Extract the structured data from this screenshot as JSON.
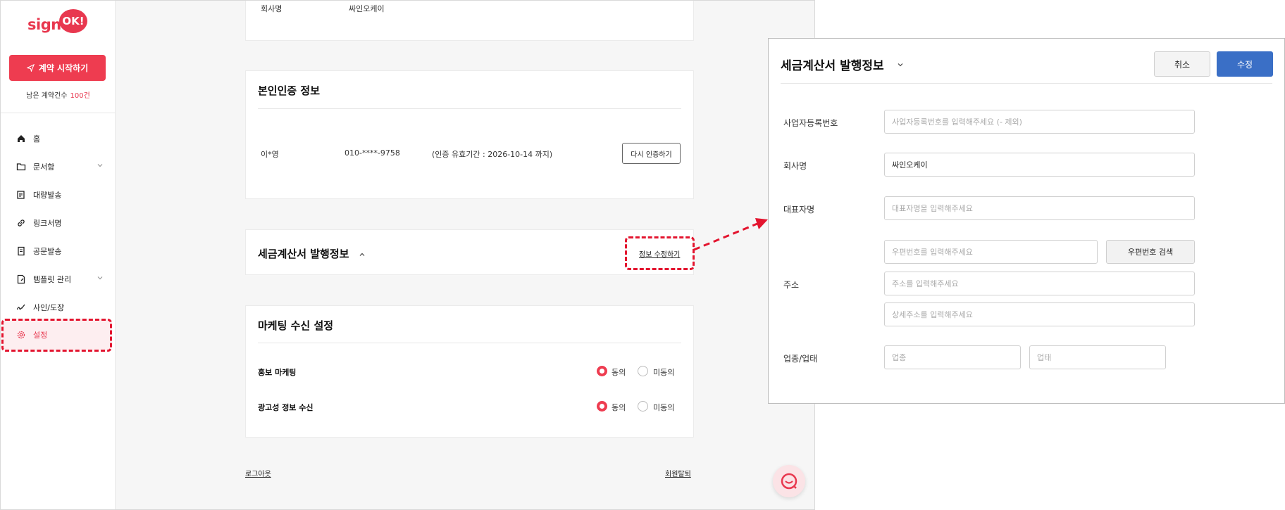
{
  "sidebar": {
    "logo_text": "sign",
    "logo_badge": "OK!",
    "start_button": "계약 시작하기",
    "remaining_label": "남은 계약건수",
    "remaining_count": "100건",
    "nav": [
      {
        "label": "홈",
        "icon": "home-icon"
      },
      {
        "label": "문서함",
        "icon": "folder-icon"
      },
      {
        "label": "대량발송",
        "icon": "bulk-send-icon"
      },
      {
        "label": "링크서명",
        "icon": "link-icon"
      },
      {
        "label": "공문발송",
        "icon": "document-icon"
      },
      {
        "label": "템플릿 관리",
        "icon": "template-icon"
      },
      {
        "label": "사인/도장",
        "icon": "signature-icon"
      },
      {
        "label": "설정",
        "icon": "gear-icon"
      }
    ]
  },
  "main": {
    "top_card": {
      "label": "회사명",
      "value": "싸인오케이"
    },
    "identity": {
      "title": "본인인증 정보",
      "name": "이*영",
      "phone": "010-****-9758",
      "validity": "(인증 유효기간 : 2026-10-14 까지)",
      "reverify_button": "다시 인증하기"
    },
    "tax_invoice": {
      "title": "세금계산서 발행정보",
      "edit_link": "정보 수정하기"
    },
    "marketing": {
      "title": "마케팅 수신 설정",
      "rows": [
        {
          "label": "홍보 마케팅",
          "agree": "동의",
          "disagree": "미동의"
        },
        {
          "label": "광고성 정보 수신",
          "agree": "동의",
          "disagree": "미동의"
        }
      ]
    },
    "logout": "로그아웃",
    "withdraw": "회원탈퇴"
  },
  "panel": {
    "title": "세금계산서 발행정보",
    "cancel_button": "취소",
    "save_button": "수정",
    "fields": {
      "biz_number_label": "사업자등록번호",
      "biz_number_placeholder": "사업자등록번호를 입력해주세요 (- 제외)",
      "company_label": "회사명",
      "company_value": "싸인오케이",
      "ceo_label": "대표자명",
      "ceo_placeholder": "대표자명을 입력해주세요",
      "address_label": "주소",
      "zipcode_placeholder": "우편번호를 입력해주세요",
      "zipcode_button": "우편번호 검색",
      "address_placeholder": "주소를 입력해주세요",
      "address_detail_placeholder": "상세주소를 입력해주세요",
      "business_label": "업종/업태",
      "business_type_placeholder": "업종",
      "business_item_placeholder": "업태"
    }
  },
  "colors": {
    "brand": "#ee3c50",
    "primary": "#3a6fc6",
    "highlight": "#e3152f"
  }
}
